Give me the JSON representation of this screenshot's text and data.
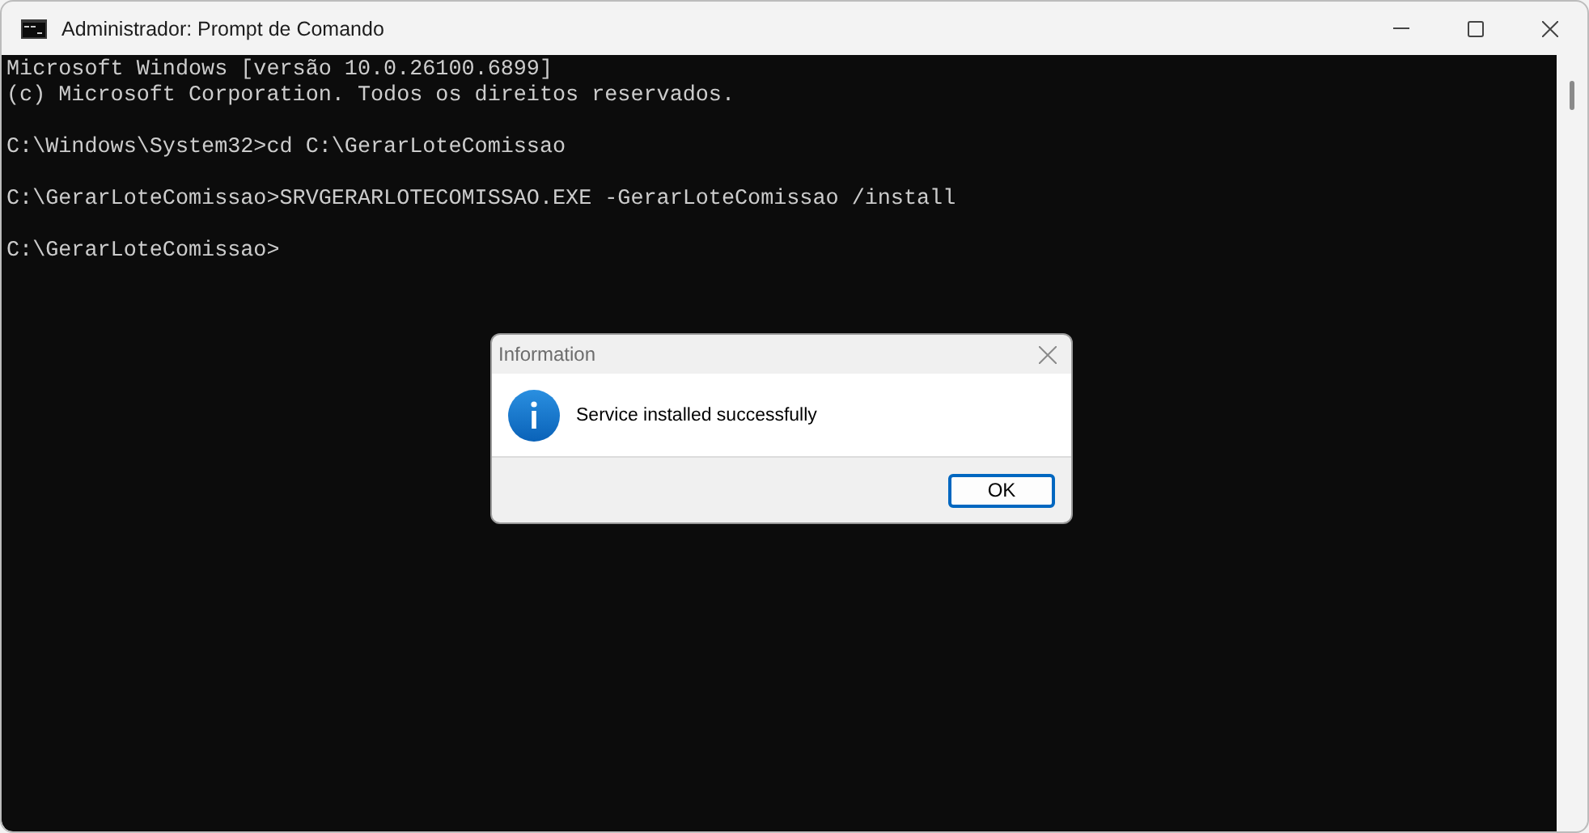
{
  "window": {
    "title": "Administrador: Prompt de Comando"
  },
  "console": {
    "lines": [
      {
        "kind": "text",
        "text": "Microsoft Windows [versão 10.0.26100.6899]"
      },
      {
        "kind": "text",
        "text": "(c) Microsoft Corporation. Todos os direitos reservados."
      },
      {
        "kind": "blank"
      },
      {
        "kind": "text",
        "text": "C:\\Windows\\System32>cd C:\\GerarLoteComissao"
      },
      {
        "kind": "blank"
      },
      {
        "kind": "text",
        "text": "C:\\GerarLoteComissao>SRVGERARLOTECOMISSAO.EXE -GerarLoteComissao /install"
      },
      {
        "kind": "blank"
      },
      {
        "kind": "text",
        "text": "C:\\GerarLoteComissao>"
      }
    ]
  },
  "dialog": {
    "title": "Information",
    "message": "Service installed successfully",
    "buttons": [
      {
        "label": "OK",
        "default": true
      }
    ]
  }
}
